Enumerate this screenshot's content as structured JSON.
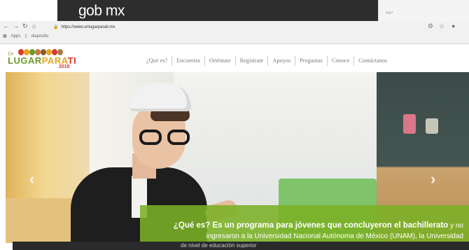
{
  "video_overlay": {
    "brand": "gob mx"
  },
  "browser": {
    "back_icon": "arrow-left-icon",
    "forward_icon": "arrow-right-icon",
    "reload_icon": "reload-icon",
    "home_icon": "home-icon",
    "lock_icon": "lock-icon",
    "url": "https://www.unlugarparati.mx",
    "bookmarks": [
      "Apps",
      "diapositiv"
    ]
  },
  "site": {
    "logo": {
      "prefix": "Un",
      "lugar": "LUGAR",
      "para": "PARA",
      "ti": "TI",
      "year": "2018"
    },
    "nav": [
      "¿Qué es?",
      "Encuentra",
      "Oriéntate",
      "Regístrate",
      "Apoyos",
      "Preguntas",
      "Conoce",
      "Contáctanos"
    ]
  },
  "hero": {
    "caption_bold": "¿Qué es? Es un programa para jóvenes que concluyeron el bachillerato",
    "caption_rest": " y no ingresaron a la Universidad Nacional Autónoma de México (UNAM), la Universidad",
    "prev_icon": "chevron-left-icon",
    "next_icon": "chevron-right-icon",
    "subtitle": "de nivel de educación superior"
  },
  "colors": {
    "accent_green": "#7bb025",
    "logo_green": "#6c9a2e",
    "logo_orange": "#e6a520",
    "logo_red": "#d7392c"
  }
}
